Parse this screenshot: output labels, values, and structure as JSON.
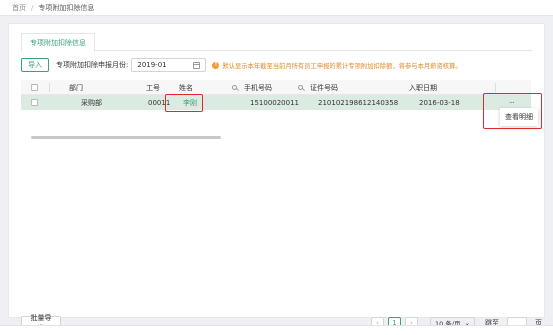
{
  "breadcrumb": {
    "home": "首页",
    "separator": "/",
    "current": "专项附加扣除信息"
  },
  "tab": {
    "label": "专项附加扣除信息"
  },
  "toolbar": {
    "import_label": "导入",
    "month_label": "专项附加扣除申报月份:",
    "month_value": "2019-01",
    "hint_icon": "!",
    "hint": "默认显示本年截至当前月所有员工申报的累计专项附加扣除额，将参与本月薪资核算。"
  },
  "table": {
    "headers": {
      "dept": "部门",
      "emp_no": "工号",
      "name": "姓名",
      "phone": "手机号码",
      "id_no": "证件号码",
      "hire_date": "入职日期"
    },
    "rows": [
      {
        "dept": "采购部",
        "emp_no": "00011",
        "name": "李刚",
        "phone": "15100020011",
        "id_no": "210102198612140358",
        "hire_date": "2016-03-18",
        "more": "···"
      }
    ]
  },
  "popup": {
    "view_detail": "查看明细"
  },
  "footer": {
    "batch_export": "批量导出",
    "prev": "‹",
    "current_page": "1",
    "next": "›",
    "page_size": "10 条/页",
    "dropdown": "⌄",
    "jump_label": "跳至",
    "page_unit": "页"
  },
  "colors": {
    "accent": "#3aa07e",
    "row_highlight": "#dcebe1",
    "warning": "#e0892a",
    "annotation": "#e02a2a"
  }
}
